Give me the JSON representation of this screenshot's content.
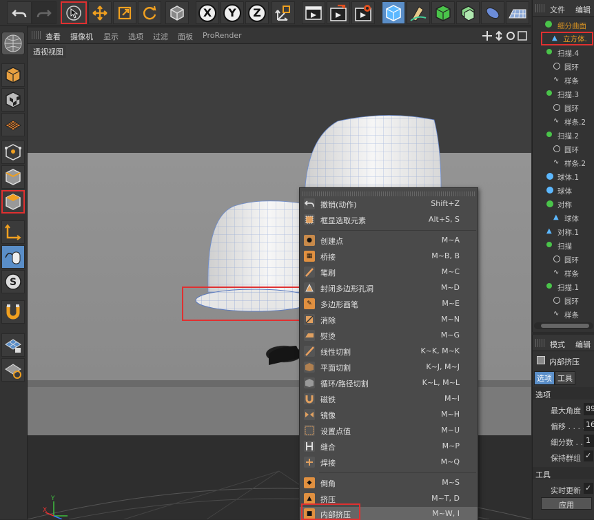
{
  "toolbar": {
    "icons": [
      "undo-icon",
      "redo-icon",
      "select-arrow-icon",
      "move-icon",
      "scale-icon",
      "rotate-icon",
      "object-cube-icon",
      "x-axis-icon",
      "y-axis-icon",
      "z-axis-icon",
      "coordinate-system-icon",
      "render-view-icon",
      "render-picture-queue-icon",
      "render-settings-icon",
      "cube-icon",
      "pen-icon",
      "generator-icon",
      "deformer-icon",
      "capsule-icon",
      "floor-icon"
    ],
    "x_label": "X",
    "y_label": "Y",
    "z_label": "Z"
  },
  "viewport_menu": {
    "items": [
      "查看",
      "摄像机",
      "显示",
      "选项",
      "过滤",
      "面板",
      "ProRender"
    ]
  },
  "viewport": {
    "label": "透视视图"
  },
  "context_menu": {
    "items": [
      {
        "label": "撤销(动作)",
        "shortcut": "Shift+Z"
      },
      {
        "label": "框显选取元素",
        "shortcut": "Alt+S, S"
      },
      {
        "label": "创建点",
        "shortcut": "M~A"
      },
      {
        "label": "桥接",
        "shortcut": "M~B, B"
      },
      {
        "label": "笔刷",
        "shortcut": "M~C"
      },
      {
        "label": "封闭多边形孔洞",
        "shortcut": "M~D"
      },
      {
        "label": "多边形画笔",
        "shortcut": "M~E"
      },
      {
        "label": "消除",
        "shortcut": "M~N"
      },
      {
        "label": "熨烫",
        "shortcut": "M~G"
      },
      {
        "label": "线性切割",
        "shortcut": "K~K, M~K"
      },
      {
        "label": "平面切割",
        "shortcut": "K~J, M~J"
      },
      {
        "label": "循环/路径切割",
        "shortcut": "K~L, M~L"
      },
      {
        "label": "磁铁",
        "shortcut": "M~I"
      },
      {
        "label": "镜像",
        "shortcut": "M~H"
      },
      {
        "label": "设置点值",
        "shortcut": "M~U"
      },
      {
        "label": "缝合",
        "shortcut": "M~P"
      },
      {
        "label": "焊接",
        "shortcut": "M~Q"
      },
      {
        "label": "倒角",
        "shortcut": "M~S"
      },
      {
        "label": "挤压",
        "shortcut": "M~T, D"
      },
      {
        "label": "内部挤压",
        "shortcut": "M~W, I"
      }
    ]
  },
  "object_manager": {
    "menu": [
      "文件",
      "编辑"
    ],
    "items": [
      {
        "label": "细分曲面"
      },
      {
        "label": "立方体."
      },
      {
        "label": "扫描.4"
      },
      {
        "label": "圆环"
      },
      {
        "label": "样条"
      },
      {
        "label": "扫描.3"
      },
      {
        "label": "圆环"
      },
      {
        "label": "样条.2"
      },
      {
        "label": "扫描.2"
      },
      {
        "label": "圆环"
      },
      {
        "label": "样条.2"
      },
      {
        "label": "球体.1"
      },
      {
        "label": "球体"
      },
      {
        "label": "对称"
      },
      {
        "label": "球体"
      },
      {
        "label": "对称.1"
      },
      {
        "label": "扫描"
      },
      {
        "label": "圆环"
      },
      {
        "label": "样条"
      },
      {
        "label": "扫描.1"
      },
      {
        "label": "圆环"
      },
      {
        "label": "样条"
      }
    ]
  },
  "attributes": {
    "menu": [
      "模式",
      "编辑"
    ],
    "tool_name": "内部挤压",
    "tabs": [
      "选项",
      "工具"
    ],
    "section_options": "选项",
    "fields": [
      {
        "label": "最大角度",
        "value": "89"
      },
      {
        "label": "偏移 . . . .",
        "value": "16"
      },
      {
        "label": "细分数 . .",
        "value": "1"
      },
      {
        "label": "保持群组",
        "value": "✓"
      }
    ],
    "section_tool": "工具",
    "realtime_label": "实时更新",
    "realtime_value": "✓",
    "apply_label": "应用"
  },
  "axis": {
    "y": "Y",
    "x": "X"
  },
  "colors": {
    "highlight_red": "#e03030",
    "selected_orange": "#f0a020",
    "tool_blue": "#5a8ec8"
  }
}
